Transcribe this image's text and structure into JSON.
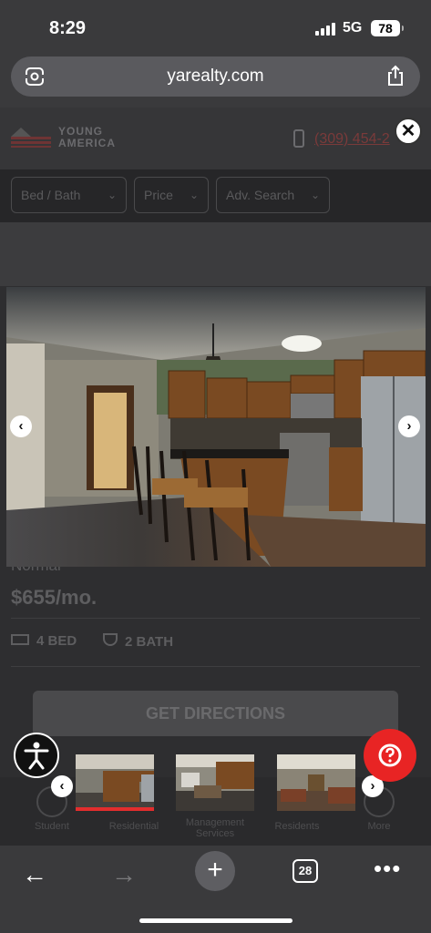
{
  "status_bar": {
    "time": "8:29",
    "network": "5G",
    "battery": "78"
  },
  "browser": {
    "url": "yarealty.com",
    "tab_count": "28"
  },
  "site": {
    "logo": {
      "line1": "YOUNG",
      "line2": "AMERICA"
    },
    "phone": "(309) 454-2",
    "filters": [
      "Bed / Bath",
      "Price",
      "Adv. Search"
    ],
    "listing_name": "Normal",
    "price": "$655/mo.",
    "beds": "4 BED",
    "baths": "2 BATH",
    "directions_label": "GET DIRECTIONS",
    "nav": [
      "Student",
      "Residential",
      "Management Services",
      "Residents",
      "More"
    ]
  },
  "lightbox": {
    "thumbnails": [
      "kitchen",
      "dining-living",
      "living-room"
    ],
    "active_index": 0
  },
  "colors": {
    "accent_red": "#e32d2d",
    "help_red": "#e82424",
    "chrome_gray": "#3a3a3c"
  },
  "icons": [
    "tune-icon",
    "share-icon",
    "close-icon",
    "chevron-left-icon",
    "chevron-right-icon",
    "accessibility-icon",
    "help-icon",
    "back-arrow-icon",
    "forward-arrow-icon",
    "plus-icon",
    "tabs-icon",
    "more-icon"
  ]
}
